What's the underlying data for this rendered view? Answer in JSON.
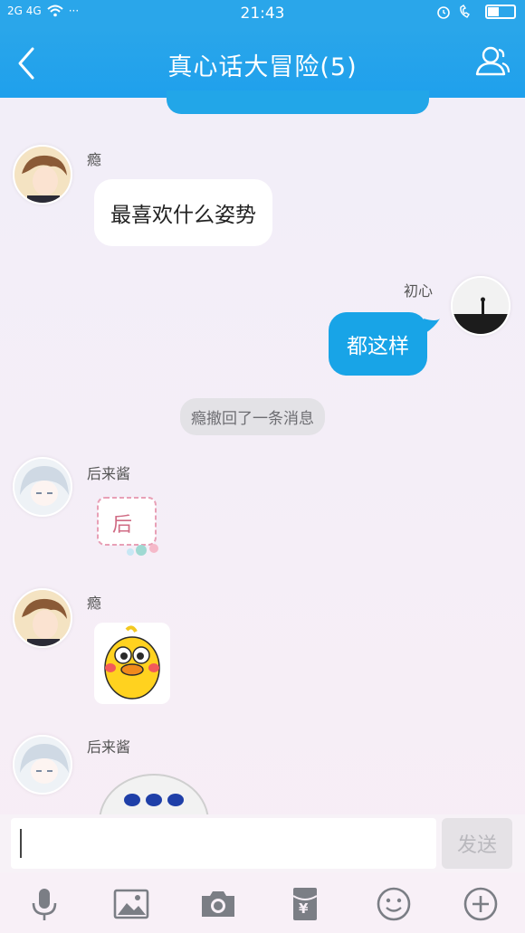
{
  "status_bar": {
    "network_left": "2G 4G",
    "dots": "···",
    "time": "21:43"
  },
  "header": {
    "title": "真心话大冒险(5)"
  },
  "messages": [
    {
      "sender": "瘾",
      "text": "最喜欢什么姿势"
    },
    {
      "sender": "初心",
      "text": "都这样"
    },
    {
      "system": "瘾撤回了一条消息"
    },
    {
      "sender": "后来酱",
      "sticker_text": "后"
    },
    {
      "sender": "瘾"
    },
    {
      "sender": "后来酱"
    }
  ],
  "input": {
    "send_label": "发送"
  },
  "toolbar": {
    "icons": [
      "mic-icon",
      "image-icon",
      "camera-icon",
      "red-packet-icon",
      "emoji-icon",
      "plus-icon"
    ],
    "red_packet_symbol": "¥"
  },
  "colors": {
    "brand_blue": "#1fa0ec",
    "bubble_blue": "#18a4e7"
  }
}
